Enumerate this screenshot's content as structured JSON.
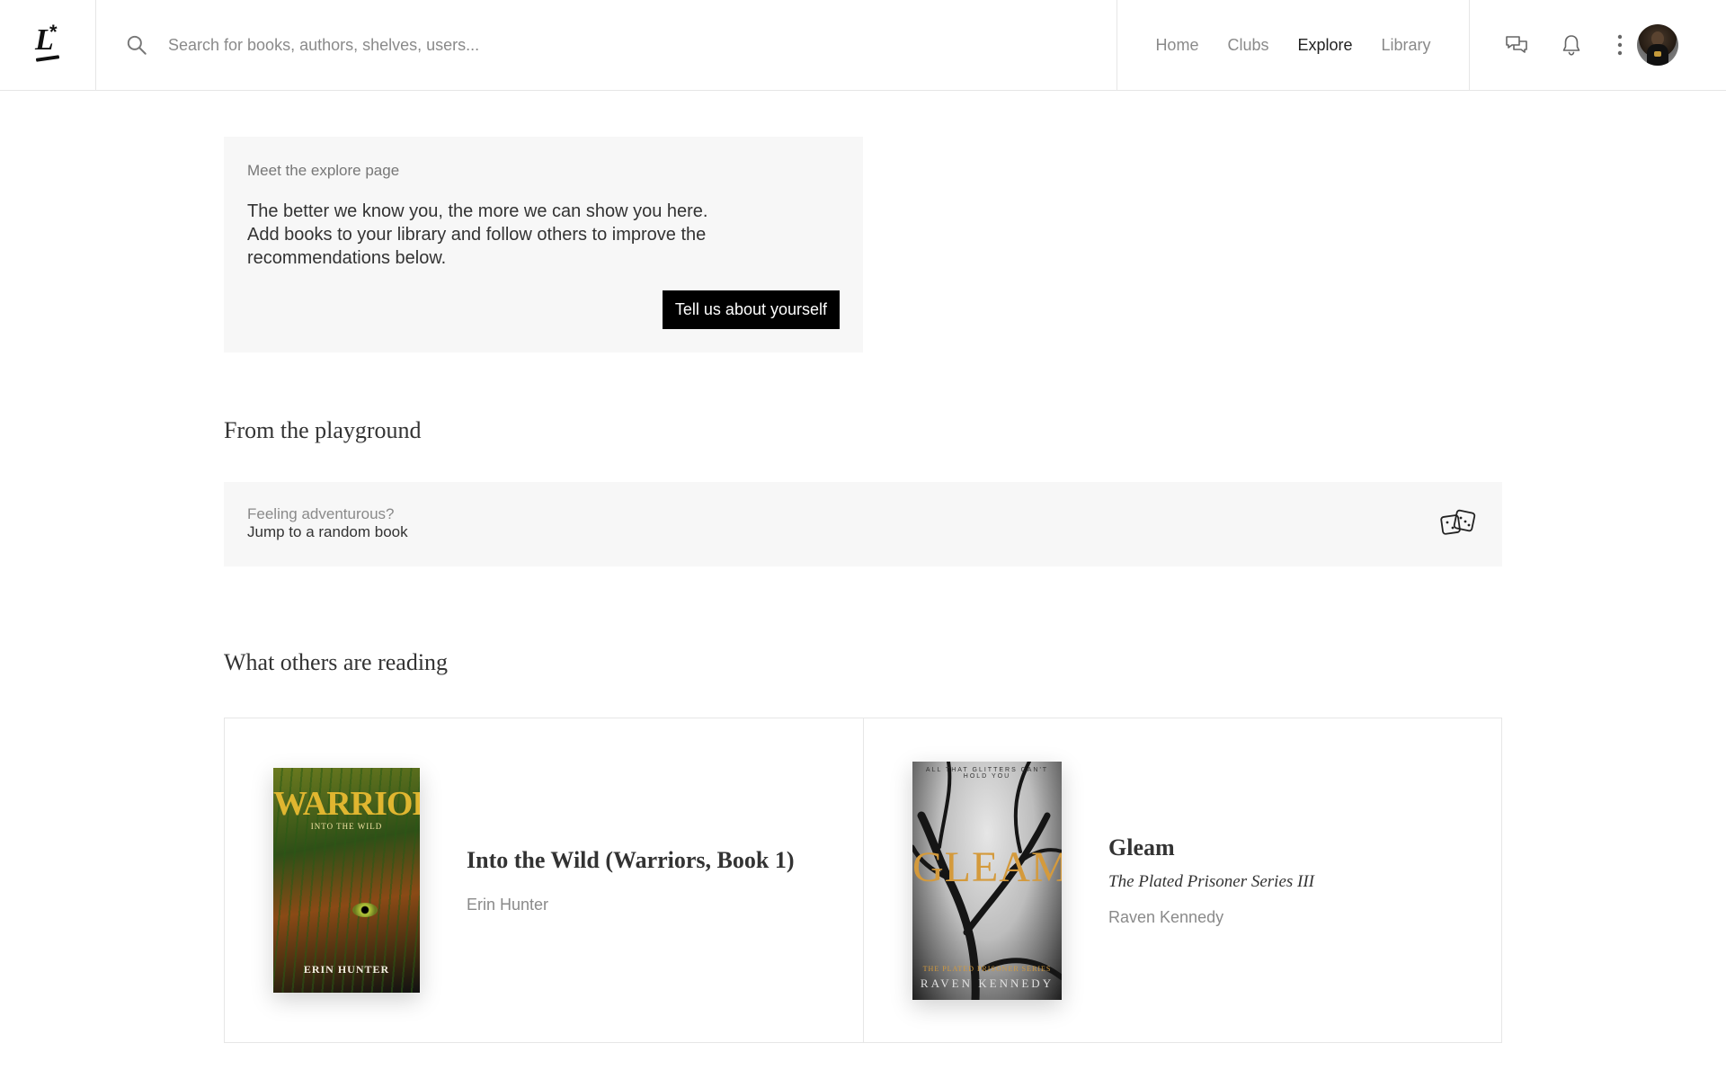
{
  "search": {
    "placeholder": "Search for books, authors, shelves, users..."
  },
  "nav": {
    "items": [
      {
        "label": "Home",
        "active": false
      },
      {
        "label": "Clubs",
        "active": false
      },
      {
        "label": "Explore",
        "active": true
      },
      {
        "label": "Library",
        "active": false
      }
    ]
  },
  "header_icons": [
    "chat-icon",
    "bell-icon",
    "kebab-menu-icon",
    "avatar"
  ],
  "intro": {
    "eyebrow": "Meet the explore page",
    "body": "The better we know you, the more we can show you here. Add books to your library and follow others to improve the recommendations below.",
    "cta_label": "Tell us about yourself"
  },
  "playground": {
    "title": "From the playground",
    "eyebrow": "Feeling adventurous?",
    "label": "Jump to a random book",
    "icon": "dice-icon"
  },
  "reading": {
    "title": "What others are reading",
    "books": [
      {
        "title": "Into the Wild (Warriors, Book 1)",
        "series": "",
        "author": "Erin Hunter",
        "cover": {
          "title": "WARRIORS",
          "subtitle": "INTO THE WILD",
          "author": "ERIN HUNTER"
        }
      },
      {
        "title": "Gleam",
        "series": "The Plated Prisoner Series III",
        "author": "Raven Kennedy",
        "cover": {
          "title": "GLEAM",
          "top": "ALL THAT GLITTERS CAN'T HOLD YOU",
          "series": "THE PLATED PRISONER SERIES",
          "author": "RAVEN KENNEDY"
        }
      }
    ]
  },
  "colors": {
    "accent": "#000000",
    "panel_bg": "#f7f7f7",
    "muted_text": "#8a8a8a",
    "border": "#e6e6e6"
  }
}
